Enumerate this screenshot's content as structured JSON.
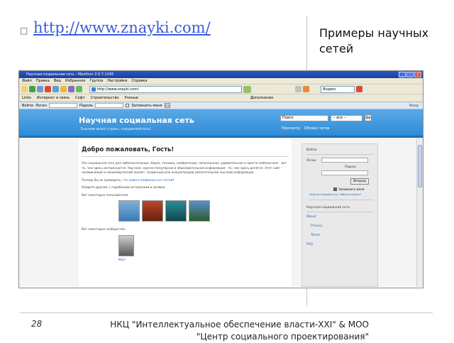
{
  "slide": {
    "bullet": "",
    "link": "http://www.znayki.com/",
    "title": "Примеры научных сетей",
    "page_number": "28",
    "footer": "НКЦ \"Интеллектуальное обеспечение власти-XXI\" & МОО \"Центр социального проектирования\""
  },
  "browser": {
    "window_title": "Научная социальная сеть - Maxthon 2.0.7.1245",
    "window_buttons": [
      "_",
      "□",
      "x"
    ],
    "menu": [
      "Файл",
      "Правка",
      "Вид",
      "Избранное",
      "Группа",
      "Настройки",
      "Справка"
    ],
    "address": "http://www.znayki.com/",
    "search_placeholder": "Яндекс",
    "links_bar": [
      "Links",
      "Интернет и связь",
      "Софт",
      "Строительство",
      "Ученые"
    ],
    "login_bar": {
      "enter": "Войти",
      "login_label": "Логин",
      "password_label": "Пароль",
      "remember": "Запомнить меня",
      "go": ">>",
      "right_text": "Вход",
      "tools_label": "Дополнение"
    }
  },
  "site": {
    "title": "Научная социальная сеть",
    "tagline": "Знания всех стран, соединяйтесь!",
    "search_placeholder": "Поиск",
    "search_scope": "-- все --",
    "search_go": "Go",
    "banner_links": [
      "Просмотр",
      "Облако тегов"
    ],
    "welcome": "Добро пожаловать, Гость!",
    "intro": "Это социальная сеть для любознательных. Наука, техника, изобретения, непознанное, удивительное и просто любопытное - вот то, чем здесь интересуются. Научная, научно-популярная и образовательная информация - то, чем здесь делятся. Этот сайт - независимый и некоммерческий проект, созданный для концентрации увлекательной научной информации.",
    "why_prefix": "Почему бы не проверить, ",
    "why_link": "что нового появилось из статей",
    "why_suffix": "?",
    "find_friends": "Найдите друзей, с подобными интересами и целями.",
    "some_users": "Вот некоторые пользователи:",
    "some_communities": "Вот некоторые сообщества:",
    "community_name": "Мозг"
  },
  "sidebar": {
    "login_head": "Войти",
    "login_label": "Логин",
    "password_label": "Пароль",
    "submit": "Вперед",
    "remember": "Запомнить меня",
    "register_links": "Зарегистрироваться | Забыли пароль?",
    "network_head": "Научная социальная сеть",
    "nav": [
      "About",
      "Privacy",
      "Terms",
      "FAQ"
    ]
  },
  "colors": {
    "link": "#3b5bd6",
    "banner": "#2f8bd6",
    "titlebar": "#1c3f9a"
  }
}
